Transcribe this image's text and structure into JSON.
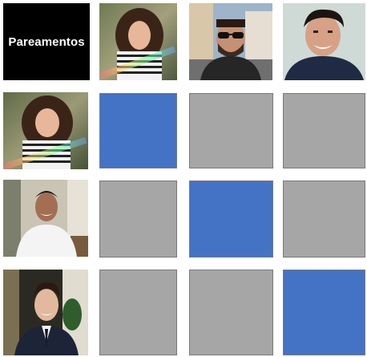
{
  "title": "Pareamentos",
  "people": {
    "columns": [
      {
        "icon": "woman-portrait-photo-1"
      },
      {
        "icon": "man-sunglasses-photo"
      },
      {
        "icon": "man-smiling-photo"
      }
    ],
    "rows": [
      {
        "icon": "woman-portrait-photo-2"
      },
      {
        "icon": "man-white-shirt-photo"
      },
      {
        "icon": "man-suit-photo"
      }
    ]
  },
  "matrix": [
    [
      "match",
      "no-match",
      "no-match"
    ],
    [
      "no-match",
      "match",
      "no-match"
    ],
    [
      "no-match",
      "no-match",
      "match"
    ]
  ],
  "colors": {
    "match": "#4472c4",
    "no-match": "#a6a6a6",
    "title_bg": "#000000",
    "title_text": "#ffffff"
  }
}
